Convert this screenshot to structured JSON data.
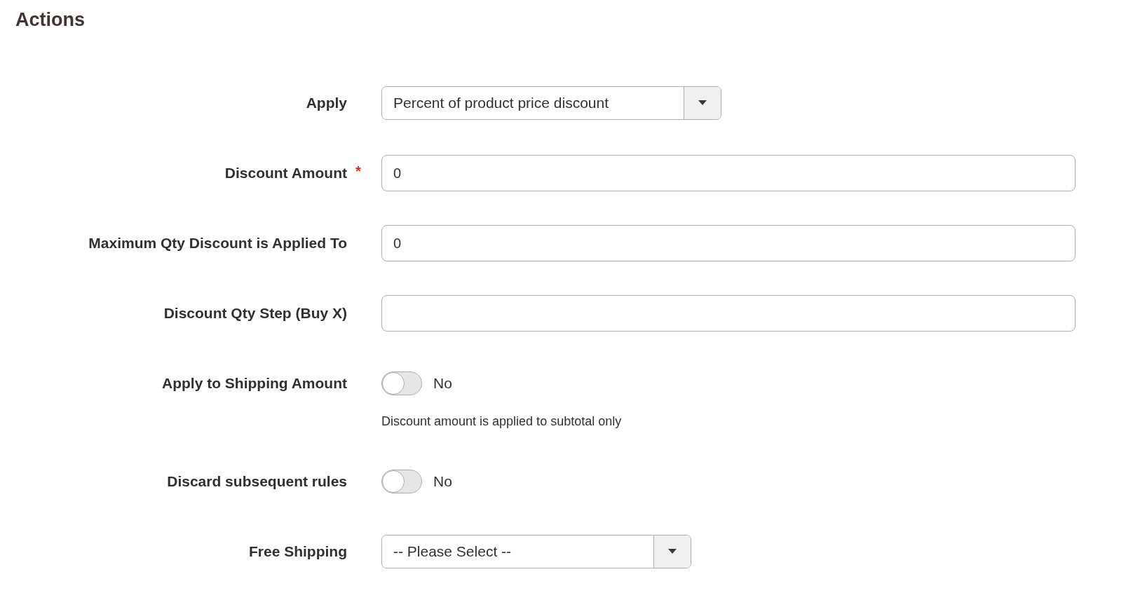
{
  "section": {
    "title": "Actions"
  },
  "fields": [
    {
      "kind": "select",
      "label": "Apply",
      "value": "Percent of product price discount"
    },
    {
      "kind": "text",
      "label": "Discount Amount",
      "required_mark": "*",
      "value": "0"
    },
    {
      "kind": "text",
      "label": "Maximum Qty Discount is Applied To",
      "value": "0"
    },
    {
      "kind": "text",
      "label": "Discount Qty Step (Buy X)"
    },
    {
      "kind": "toggle",
      "label": "Apply to Shipping Amount",
      "on": false,
      "state_text": "No",
      "note": "Discount amount is applied to subtotal only"
    },
    {
      "kind": "toggle",
      "label": "Discard subsequent rules",
      "on": false,
      "state_text": "No"
    },
    {
      "kind": "select",
      "label": "Free Shipping",
      "value": "-- Please Select --"
    }
  ]
}
